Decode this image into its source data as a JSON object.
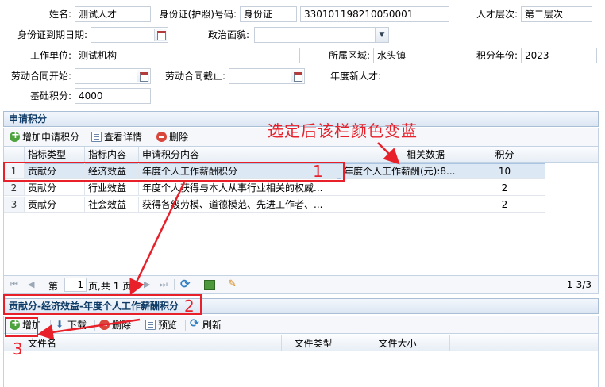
{
  "form": {
    "name_label": "姓名:",
    "name_value": "测试人才",
    "idcard_label": "身份证(护照)号码:",
    "idcard_type": "身份证",
    "idcard_number": "330101198210050001",
    "talent_level_label": "人才层次:",
    "talent_level_value": "第二层次",
    "id_expiry_label": "身份证到期日期:",
    "id_expiry_value": "",
    "political_label": "政治面貌:",
    "political_value": "",
    "workplace_label": "工作单位:",
    "workplace_value": "测试机构",
    "region_label": "所属区域:",
    "region_value": "水头镇",
    "score_year_label": "积分年份:",
    "score_year_value": "2023",
    "contract_start_label": "劳动合同开始:",
    "contract_start_value": "",
    "contract_end_label": "劳动合同截止:",
    "contract_end_value": "",
    "annual_new_label": "年度新人才:",
    "base_score_label": "基础积分:",
    "base_score_value": "4000"
  },
  "apply_panel": {
    "title": "申请积分",
    "toolbar": {
      "add": "增加申请积分",
      "view": "查看详情",
      "delete": "删除"
    },
    "columns": [
      "指标类型",
      "指标内容",
      "申请积分内容",
      "相关数据",
      "积分"
    ],
    "rows": [
      {
        "num": "1",
        "type": "贡献分",
        "content": "经济效益",
        "item": "年度个人工作薪酬积分",
        "data": "年度个人工作薪酬(元):8...",
        "score": "10"
      },
      {
        "num": "2",
        "type": "贡献分",
        "content": "行业效益",
        "item": "年度个人获得与本人从事行业相关的权威...",
        "data": "",
        "score": "2"
      },
      {
        "num": "3",
        "type": "贡献分",
        "content": "社会效益",
        "item": "获得各级劳模、道德模范、先进工作者、...",
        "data": "",
        "score": "2"
      }
    ],
    "pager": {
      "page_label_pre": "第",
      "page_value": "1",
      "page_label_post": "页,共 1 页",
      "range": "1-3/3"
    }
  },
  "files_panel": {
    "title": "贡献分-经济效益-年度个人工作薪酬积分",
    "toolbar": {
      "add": "增加",
      "download": "下载",
      "delete": "删除",
      "preview": "预览",
      "refresh": "刷新"
    },
    "columns": [
      "文件名",
      "文件类型",
      "文件大小"
    ]
  },
  "annotations": {
    "note": "选定后该栏颜色变蓝",
    "num1": "1",
    "num2": "2",
    "num3": "3",
    "color": "#e8202a"
  }
}
